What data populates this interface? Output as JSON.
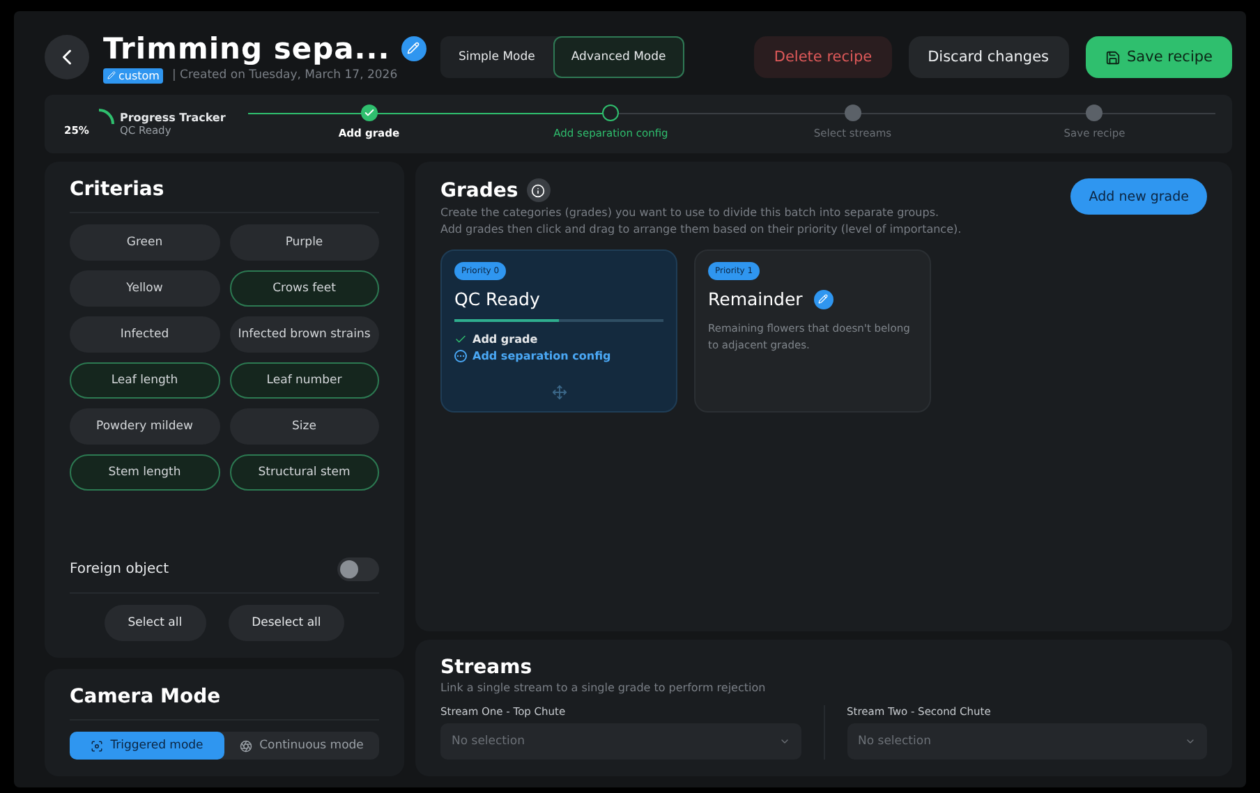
{
  "header": {
    "title": "Trimming sepa...",
    "tag": "custom",
    "created": "| Created on Tuesday, March 17, 2026"
  },
  "modes": [
    {
      "label": "Simple Mode",
      "selected": false
    },
    {
      "label": "Advanced Mode",
      "selected": true
    }
  ],
  "actions": [
    {
      "label": "Delete recipe",
      "kind": "danger"
    },
    {
      "label": "Discard changes",
      "kind": "neutral"
    },
    {
      "label": "Save recipe",
      "kind": "primary"
    }
  ],
  "progress": {
    "reading": "25%",
    "title": "Progress Tracker",
    "subtitle": "QC Ready",
    "steps": [
      {
        "label": "Add grade",
        "kind": "done"
      },
      {
        "label": "Add separation config",
        "kind": "current"
      },
      {
        "label": "Select streams",
        "kind": "pending"
      },
      {
        "label": "Save recipe",
        "kind": "pending"
      }
    ]
  },
  "criterias": {
    "title": "Criterias",
    "items": [
      {
        "label": "Green",
        "selected": false
      },
      {
        "label": "Purple",
        "selected": false
      },
      {
        "label": "Yellow",
        "selected": false
      },
      {
        "label": "Crows feet",
        "selected": true
      },
      {
        "label": "Infected",
        "selected": false
      },
      {
        "label": "Infected brown strains",
        "selected": false
      },
      {
        "label": "Leaf length",
        "selected": true
      },
      {
        "label": "Leaf number",
        "selected": true
      },
      {
        "label": "Powdery mildew",
        "selected": false
      },
      {
        "label": "Size",
        "selected": false
      },
      {
        "label": "Stem length",
        "selected": true
      },
      {
        "label": "Structural stem",
        "selected": true
      }
    ],
    "foreign": {
      "label": "Foreign object",
      "on": false
    },
    "buttons": [
      "Select all",
      "Deselect all"
    ]
  },
  "camera": {
    "title": "Camera Mode",
    "options": [
      {
        "label": "Triggered mode",
        "selected": true
      },
      {
        "label": "Continuous mode",
        "selected": false
      }
    ]
  },
  "grades": {
    "title": "Grades",
    "add": "Add new grade",
    "description": "Create the categories (grades) you want to use to divide this batch into separate groups.\nAdd grades then click and drag to arrange them based on their priority (level of importance).",
    "cards": [
      {
        "priority": "Priority 0",
        "name": "QC Ready",
        "selected": true,
        "level": 0.5,
        "steps": [
          {
            "label": "Add grade",
            "done": true
          },
          {
            "label": "Add separation config",
            "done": false
          }
        ]
      },
      {
        "priority": "Priority 1",
        "name": "Remainder",
        "selected": false,
        "description": "Remaining flowers that doesn't belong to adjacent grades."
      }
    ]
  },
  "streams": {
    "title": "Streams",
    "subtitle": "Link a single stream to a single grade to perform rejection",
    "fields": [
      {
        "label": "Stream One - Top Chute",
        "placeholder": "No selection"
      },
      {
        "label": "Stream Two - Second Chute",
        "placeholder": "No selection"
      }
    ]
  }
}
